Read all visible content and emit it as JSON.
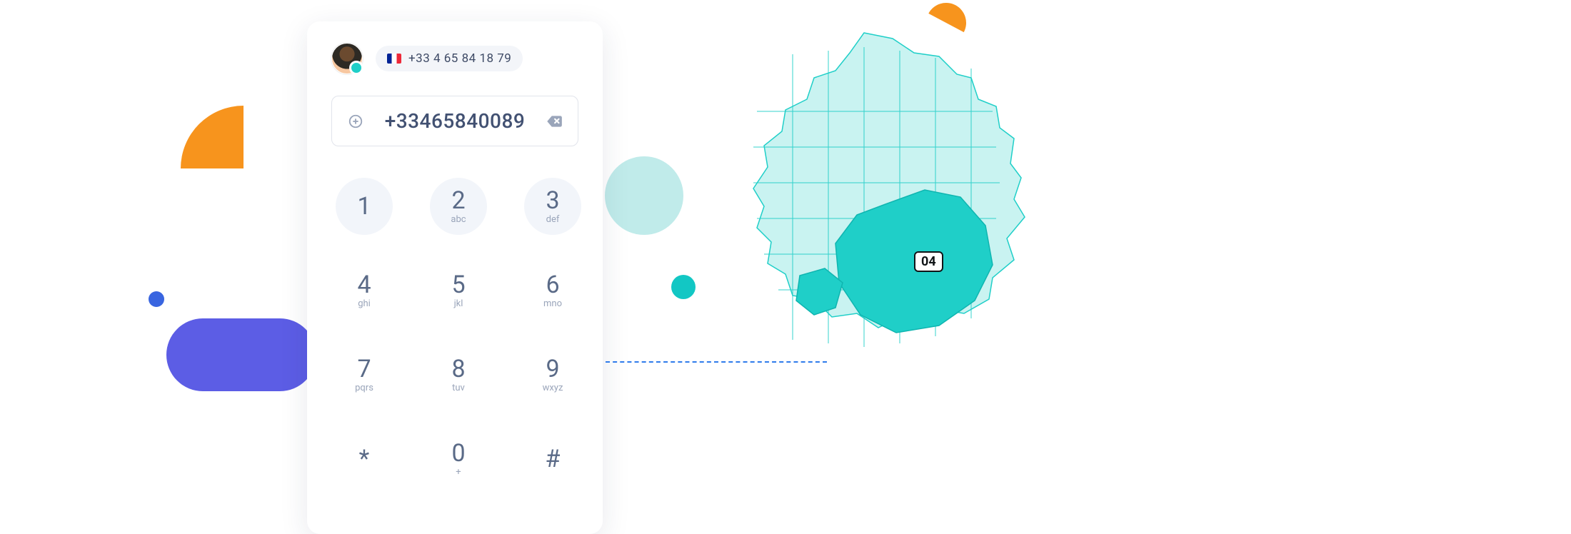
{
  "header": {
    "display_number": "+33 4 65 84 18 79"
  },
  "input": {
    "value": "+33465840089"
  },
  "keys": [
    {
      "digit": "1",
      "letters": "",
      "circle": true
    },
    {
      "digit": "2",
      "letters": "abc",
      "circle": true
    },
    {
      "digit": "3",
      "letters": "def",
      "circle": true
    },
    {
      "digit": "4",
      "letters": "ghi",
      "circle": false
    },
    {
      "digit": "5",
      "letters": "jkl",
      "circle": false
    },
    {
      "digit": "6",
      "letters": "mno",
      "circle": false
    },
    {
      "digit": "7",
      "letters": "pqrs",
      "circle": false
    },
    {
      "digit": "8",
      "letters": "tuv",
      "circle": false
    },
    {
      "digit": "9",
      "letters": "wxyz",
      "circle": false
    },
    {
      "digit": "*",
      "letters": "",
      "circle": false
    },
    {
      "digit": "0",
      "letters": "+",
      "circle": false
    },
    {
      "digit": "#",
      "letters": "",
      "circle": false
    }
  ],
  "region_label": "04"
}
